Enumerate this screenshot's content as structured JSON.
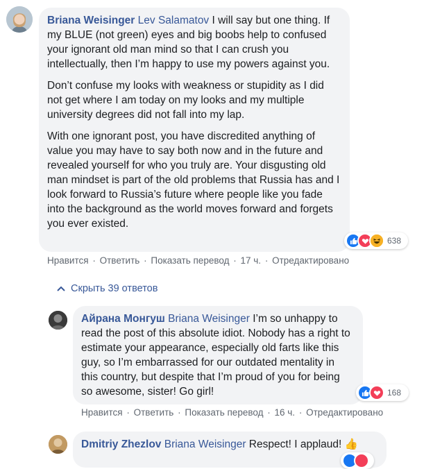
{
  "comments": [
    {
      "author": "Briana Weisinger",
      "mention": "Lev Salamatov",
      "paragraph1": " I will say but one thing. If my BLUE (not green) eyes and big boobs help to confused your ignorant old man mind so that I can crush you intellectually, then I’m happy to use my powers against you.",
      "paragraph2": "Don’t confuse my looks with weakness or stupidity as I did not get where I am today on my looks and my multiple university degrees did not fall into my lap.",
      "paragraph3": "With one ignorant post, you have discredited anything of value you may have to say both now and in the future and revealed yourself for who you truly are. Your disgusting old man mindset is part of the old problems that Russia has and I look forward to Russia’s future where people like you fade into the background as the world moves forward and forgets you ever existed.",
      "reaction_count": "638",
      "reactions": [
        "like-icon",
        "love-icon",
        "haha-icon"
      ],
      "actions": {
        "like": "Нравится",
        "reply": "Ответить",
        "translate": "Показать перевод",
        "time": "17 ч.",
        "edited": "Отредактировано"
      }
    },
    {
      "author": "Айрана Монгуш",
      "mention": "Briana Weisinger",
      "text": " I’m so unhappy to read the post of this absolute idiot. Nobody has a right to estimate your appearance, especially old farts like this guy, so I’m embarrassed for our outdated mentality in this country, but despite that I’m proud of you for being so awesome, sister! Go girl!",
      "reaction_count": "168",
      "reactions": [
        "like-icon",
        "love-icon"
      ],
      "actions": {
        "like": "Нравится",
        "reply": "Ответить",
        "translate": "Показать перевод",
        "time": "16 ч.",
        "edited": "Отредактировано"
      }
    },
    {
      "author": "Dmitriy Zhezlov",
      "mention": "Briana Weisinger",
      "text": " Respect! I applaud!",
      "emoji": "👍",
      "reactions": [
        "like-icon",
        "love-icon"
      ]
    }
  ],
  "replies_toggle": {
    "label": "Скрыть 39 ответов",
    "icon": "chevron-up-icon"
  },
  "separator": "·",
  "colors": {
    "bubble": "#f2f3f5",
    "author": "#385898",
    "text": "#1c1e21",
    "meta": "#606770",
    "like": "#1877f2",
    "love": "#f33e58",
    "haha": "#f7b125"
  }
}
